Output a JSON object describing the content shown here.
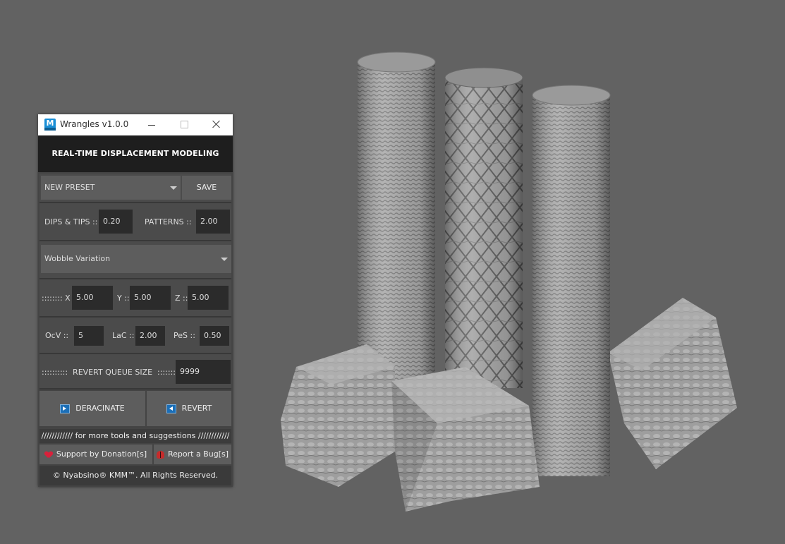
{
  "window": {
    "title": "Wrangles v1.0.0",
    "icon_letter": "M"
  },
  "header": {
    "title": "REAL-TIME DISPLACEMENT MODELING"
  },
  "preset": {
    "value": "NEW PRESET",
    "save_label": "SAVE"
  },
  "params": {
    "dips_label": "DIPS & TIPS ::",
    "dips_value": "0.20",
    "patterns_label": "PATTERNS ::",
    "patterns_value": "2.00"
  },
  "variation": {
    "value": "Wobble Variation"
  },
  "xyz": {
    "prefix": ":::::::: X ::",
    "x_value": "5.00",
    "y_label": "Y ::",
    "y_value": "5.00",
    "z_label": "Z ::",
    "z_value": "5.00"
  },
  "noise": {
    "ocv_label": "OcV ::",
    "ocv_value": "5",
    "lac_label": "LaC ::",
    "lac_value": "2.00",
    "pes_label": "PeS ::",
    "pes_value": "0.50"
  },
  "revert_queue": {
    "label": "::::::::::  REVERT QUEUE SIZE  ::::::::::::::::",
    "value": "9999"
  },
  "actions": {
    "deracinate_label": "DERACINATE",
    "revert_label": "REVERT"
  },
  "footer": {
    "more_tools": "//////////// for more tools and suggestions ////////////",
    "donation_label": "Support by Donation[s]",
    "bug_label": "Report a Bug[s]",
    "copyright": "© Nyabsino® KMM™. All Rights Reserved."
  },
  "colors": {
    "background": "#626262",
    "panel": "#4b4b4b",
    "field": "#2b2b2b",
    "header": "#1e1e1e",
    "accent_blue": "#1b6fb8",
    "heart_red": "#d9213b"
  }
}
